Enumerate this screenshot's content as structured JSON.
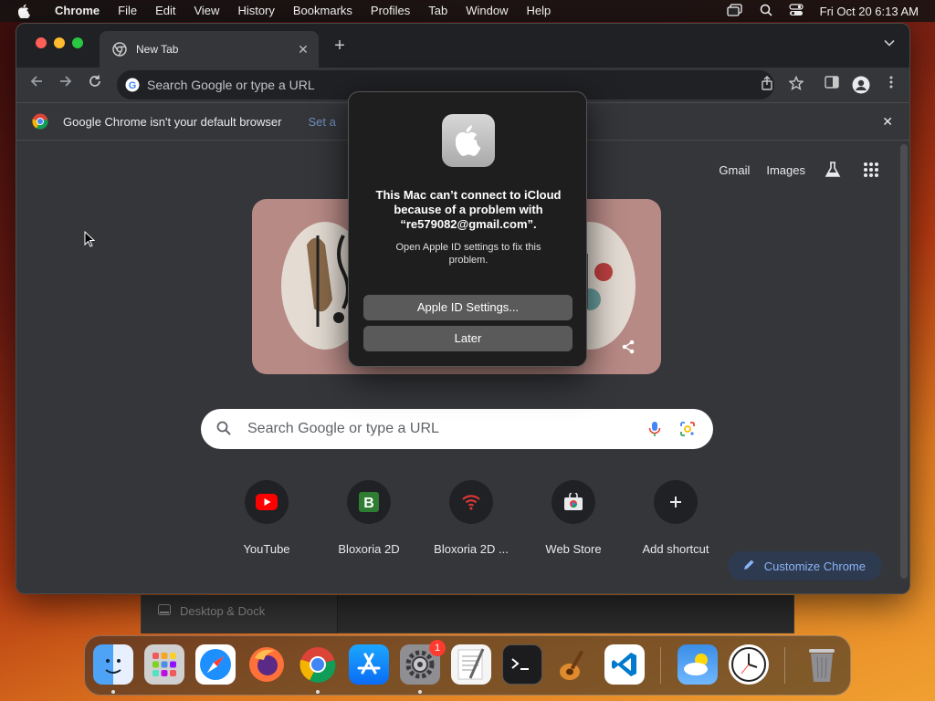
{
  "menubar": {
    "app_name": "Chrome",
    "items": [
      "File",
      "Edit",
      "View",
      "History",
      "Bookmarks",
      "Profiles",
      "Tab",
      "Window",
      "Help"
    ],
    "clock": "Fri Oct 20  6:13 AM"
  },
  "background_window": {
    "row_label": "Desktop & Dock"
  },
  "chrome": {
    "tab_title": "New Tab",
    "omnibox_placeholder": "Search Google or type a URL",
    "infobar": {
      "message": "Google Chrome isn't your default browser",
      "action": "Set a"
    },
    "top_links": {
      "gmail": "Gmail",
      "images": "Images"
    },
    "search_placeholder": "Search Google or type a URL",
    "shortcuts": [
      {
        "label": "YouTube",
        "icon": "youtube-icon"
      },
      {
        "label": "Bloxoria 2D",
        "icon": "bloxoria-icon"
      },
      {
        "label": "Bloxoria 2D ...",
        "icon": "wifi-icon"
      },
      {
        "label": "Web Store",
        "icon": "web-store-icon"
      },
      {
        "label": "Add shortcut",
        "icon": "plus-icon"
      }
    ],
    "customize_label": "Customize Chrome"
  },
  "dialog": {
    "title": "This Mac can’t connect to iCloud because of a problem with “re579082@gmail.com”.",
    "message": "Open Apple ID settings to fix this problem.",
    "primary_button": "Apple ID Settings...",
    "secondary_button": "Later"
  },
  "dock": {
    "apps": [
      "Finder",
      "Launchpad",
      "Safari",
      "Firefox",
      "Google Chrome",
      "App Store",
      "System Settings",
      "TextEdit",
      "Terminal",
      "GarageBand",
      "Visual Studio Code",
      "Weather",
      "Clock",
      "Trash"
    ],
    "system_settings_badge": "1"
  },
  "colors": {
    "chrome_bg": "#35363a",
    "tabstrip": "#202124",
    "link_blue": "#8ab4f8",
    "dialog_bg": "#1e1e1e",
    "button_gray": "#5a5a5a"
  }
}
